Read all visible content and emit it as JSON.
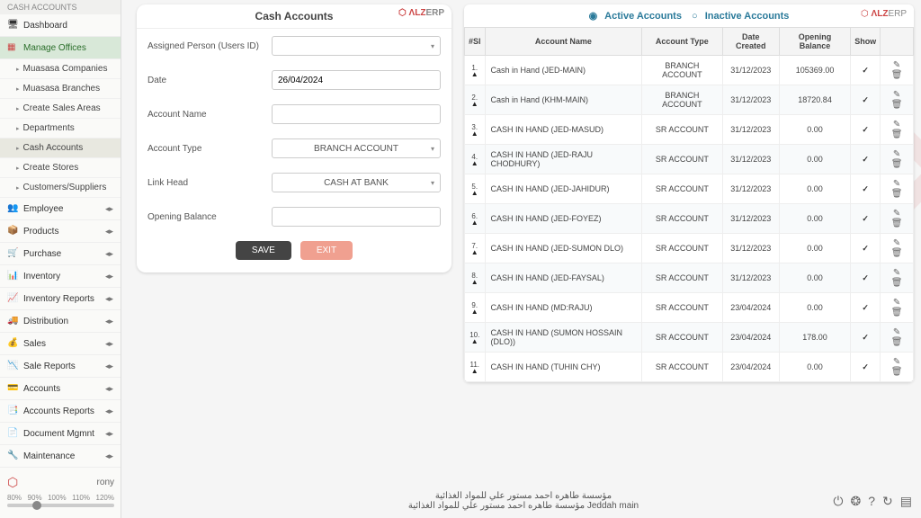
{
  "crumb": "CASH ACCOUNTS",
  "nav": {
    "dashboard": "Dashboard",
    "manage_offices": "Manage Offices",
    "subs": [
      "Muasasa Companies",
      "Muasasa Branches",
      "Create Sales Areas",
      "Departments",
      "Cash Accounts",
      "Create Stores",
      "Customers/Suppliers"
    ],
    "rest": [
      "Employee",
      "Products",
      "Purchase",
      "Inventory",
      "Inventory Reports",
      "Distribution",
      "Sales",
      "Sale Reports",
      "Accounts",
      "Accounts Reports",
      "Document Mgmnt",
      "Maintenance"
    ]
  },
  "user": "rony",
  "zoom": [
    "80%",
    "90%",
    "100%",
    "110%",
    "120%"
  ],
  "form": {
    "title": "Cash Accounts",
    "labels": {
      "assigned": "Assigned Person (Users ID)",
      "date": "Date",
      "account_name": "Account Name",
      "account_type": "Account Type",
      "link_head": "Link Head",
      "opening": "Opening Balance"
    },
    "values": {
      "date": "26/04/2024",
      "account_type": "BRANCH ACCOUNT",
      "link_head": "CASH AT BANK"
    },
    "buttons": {
      "save": "SAVE",
      "exit": "EXIT"
    }
  },
  "table": {
    "tabs": {
      "active": "Active Accounts",
      "inactive": "Inactive Accounts"
    },
    "headers": [
      "#Sl",
      "Account Name",
      "Account Type",
      "Date Created",
      "Opening Balance",
      "Show"
    ],
    "rows": [
      {
        "sl": "1.",
        "name": "Cash in Hand (JED-MAIN)",
        "type": "BRANCH ACCOUNT",
        "date": "31/12/2023",
        "bal": "105369.00"
      },
      {
        "sl": "2.",
        "name": "Cash in Hand (KHM-MAIN)",
        "type": "BRANCH ACCOUNT",
        "date": "31/12/2023",
        "bal": "18720.84"
      },
      {
        "sl": "3.",
        "name": "CASH IN HAND (JED-MASUD)",
        "type": "SR ACCOUNT",
        "date": "31/12/2023",
        "bal": "0.00"
      },
      {
        "sl": "4.",
        "name": "CASH IN HAND (JED-RAJU CHODHURY)",
        "type": "SR ACCOUNT",
        "date": "31/12/2023",
        "bal": "0.00"
      },
      {
        "sl": "5.",
        "name": "CASH IN HAND (JED-JAHIDUR)",
        "type": "SR ACCOUNT",
        "date": "31/12/2023",
        "bal": "0.00"
      },
      {
        "sl": "6.",
        "name": "CASH IN HAND (JED-FOYEZ)",
        "type": "SR ACCOUNT",
        "date": "31/12/2023",
        "bal": "0.00"
      },
      {
        "sl": "7.",
        "name": "CASH IN HAND (JED-SUMON DLO)",
        "type": "SR ACCOUNT",
        "date": "31/12/2023",
        "bal": "0.00"
      },
      {
        "sl": "8.",
        "name": "CASH IN HAND (JED-FAYSAL)",
        "type": "SR ACCOUNT",
        "date": "31/12/2023",
        "bal": "0.00"
      },
      {
        "sl": "9.",
        "name": "CASH IN HAND (MD:RAJU)",
        "type": "SR ACCOUNT",
        "date": "23/04/2024",
        "bal": "0.00"
      },
      {
        "sl": "10.",
        "name": "CASH IN HAND (SUMON HOSSAIN (DLO))",
        "type": "SR ACCOUNT",
        "date": "23/04/2024",
        "bal": "178.00"
      },
      {
        "sl": "11.",
        "name": "CASH IN HAND (TUHIN CHY)",
        "type": "SR ACCOUNT",
        "date": "23/04/2024",
        "bal": "0.00"
      }
    ]
  },
  "brand": {
    "logo": "⬡",
    "name": "ΛLZ",
    "suffix": "ERP"
  },
  "footer": {
    "line1": "مؤسسة طاهره احمد مستور علي للمواد الغذائية",
    "line2": "Jeddah main مؤسسة طاهره احمد مستور علي للمواد الغذائية"
  }
}
